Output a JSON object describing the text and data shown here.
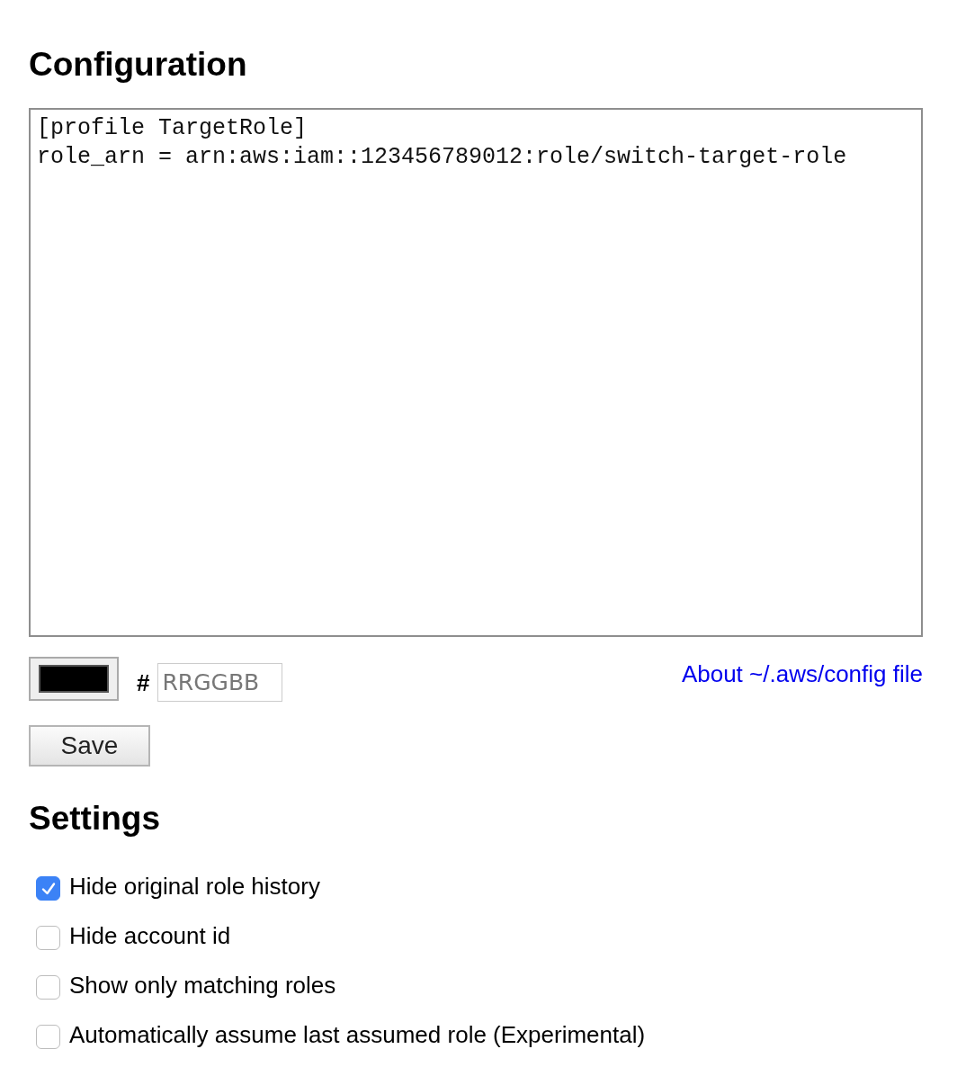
{
  "configuration": {
    "title": "Configuration",
    "config_lines": [
      "[profile TargetRole]",
      "role_arn = arn:aws:iam::123456789012:role/switch-target-role"
    ],
    "color_swatch": {
      "color": "#000000"
    },
    "hash_label": "#",
    "color_input": {
      "placeholder": "RRGGBB"
    },
    "help_link": "About ~/.aws/config file",
    "save_button": "Save"
  },
  "settings": {
    "title": "Settings",
    "options": [
      {
        "label": "Hide original role history",
        "checked": true
      },
      {
        "label": "Hide account id",
        "checked": false
      },
      {
        "label": "Show only matching roles",
        "checked": false
      },
      {
        "label": "Automatically assume last assumed role (Experimental)",
        "checked": false
      }
    ]
  }
}
